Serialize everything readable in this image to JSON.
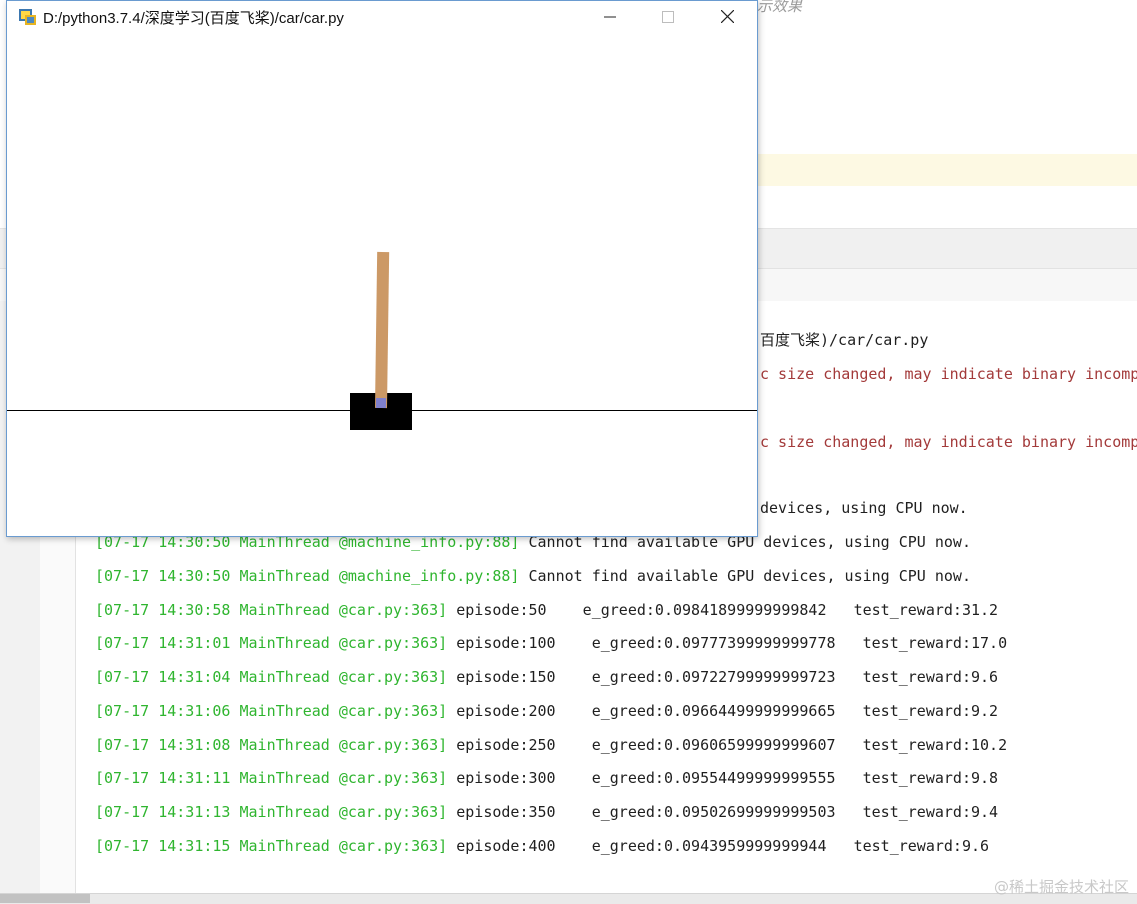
{
  "ide": {
    "editor_hint": "示效果",
    "console": {
      "lines": [
        {
          "type": "tail",
          "text": "百度飞桨)/car/car.py"
        },
        {
          "type": "warn",
          "text": "c size changed, may indicate binary incomp"
        },
        {
          "type": "warn",
          "text": "c size changed, may indicate binary incomp"
        },
        {
          "type": "tail",
          "text": "devices, using CPU now."
        }
      ],
      "log": [
        {
          "ts": "[07-17 14:30:50 MainThread @machine_info.py:88]",
          "msg": " Cannot find available GPU devices, using CPU now."
        },
        {
          "ts": "[07-17 14:30:50 MainThread @machine_info.py:88]",
          "msg": " Cannot find available GPU devices, using CPU now."
        },
        {
          "ts": "[07-17 14:30:58 MainThread @car.py:363]",
          "msg": " episode:50    e_greed:0.09841899999999842   test_reward:31.2"
        },
        {
          "ts": "[07-17 14:31:01 MainThread @car.py:363]",
          "msg": " episode:100    e_greed:0.09777399999999778   test_reward:17.0"
        },
        {
          "ts": "[07-17 14:31:04 MainThread @car.py:363]",
          "msg": " episode:150    e_greed:0.09722799999999723   test_reward:9.6"
        },
        {
          "ts": "[07-17 14:31:06 MainThread @car.py:363]",
          "msg": " episode:200    e_greed:0.09664499999999665   test_reward:9.2"
        },
        {
          "ts": "[07-17 14:31:08 MainThread @car.py:363]",
          "msg": " episode:250    e_greed:0.09606599999999607   test_reward:10.2"
        },
        {
          "ts": "[07-17 14:31:11 MainThread @car.py:363]",
          "msg": " episode:300    e_greed:0.09554499999999555   test_reward:9.8"
        },
        {
          "ts": "[07-17 14:31:13 MainThread @car.py:363]",
          "msg": " episode:350    e_greed:0.09502699999999503   test_reward:9.4"
        },
        {
          "ts": "[07-17 14:31:15 MainThread @car.py:363]",
          "msg": " episode:400    e_greed:0.0943959999999944   test_reward:9.6"
        }
      ]
    },
    "watermark": "@稀土掘金技术社区"
  },
  "window": {
    "title": "D:/python3.7.4/深度学习(百度飞桨)/car/car.py",
    "icon": "python-icon",
    "controls": {
      "minimize": "minimize-icon",
      "maximize": "maximize-icon",
      "close": "close-icon"
    }
  },
  "colors": {
    "pole": "#cc9966",
    "cart": "#000000",
    "axle": "#8080cc",
    "log_timestamp": "#2fb52f",
    "warning": "#a33a3a"
  }
}
